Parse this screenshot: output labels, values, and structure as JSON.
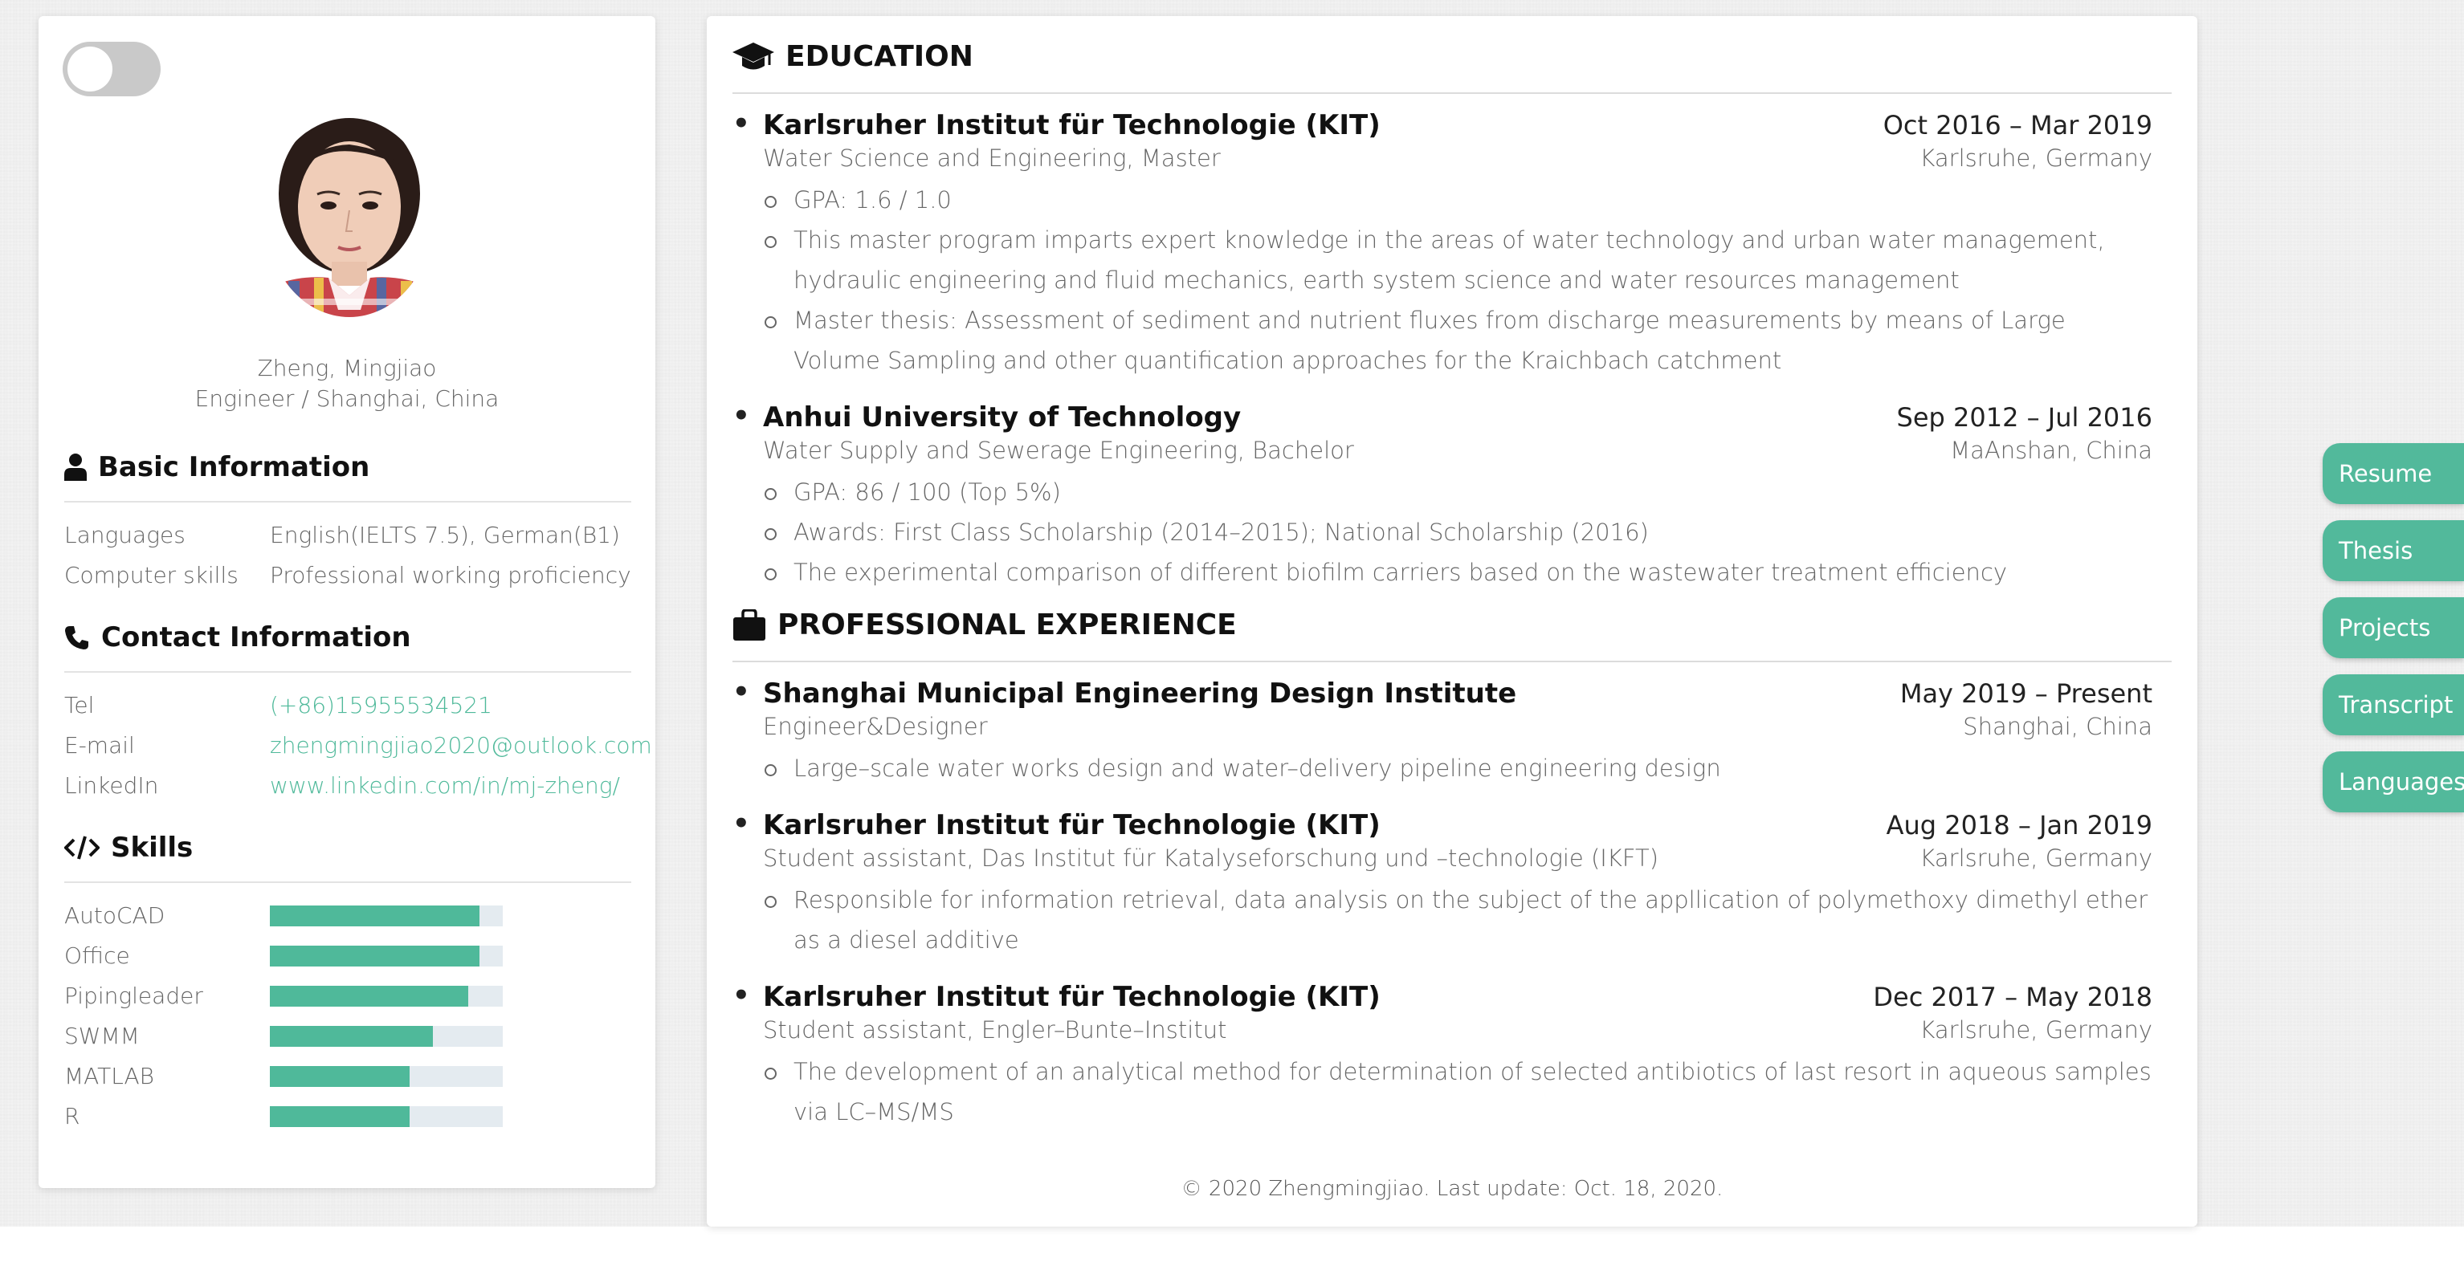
{
  "profile": {
    "name": "Zheng, Mingjiao",
    "title": "Engineer / Shanghai, China"
  },
  "basic_info": {
    "heading": "Basic Information",
    "rows": [
      {
        "k": "Languages",
        "v": "English(IELTS 7.5), German(B1)"
      },
      {
        "k": "Computer skills",
        "v": "Professional working proficiency"
      }
    ]
  },
  "contact": {
    "heading": "Contact Information",
    "rows": [
      {
        "k": "Tel",
        "v": "(+86)15955534521"
      },
      {
        "k": "E-mail",
        "v": "zhengmingjiao2020@outlook.com"
      },
      {
        "k": "LinkedIn",
        "v": "www.linkedin.com/in/mj-zheng/"
      }
    ]
  },
  "skills": {
    "heading": "Skills",
    "items": [
      {
        "name": "AutoCAD",
        "level": 0.9
      },
      {
        "name": "Office",
        "level": 0.9
      },
      {
        "name": "Pipingleader",
        "level": 0.85
      },
      {
        "name": "SWMM",
        "level": 0.7
      },
      {
        "name": "MATLAB",
        "level": 0.6
      },
      {
        "name": "R",
        "level": 0.6
      }
    ]
  },
  "education": {
    "heading": "EDUCATION",
    "entries": [
      {
        "org": "Karlsruher Institut für Technologie (KIT)",
        "date": "Oct 2016 – Mar 2019",
        "role": "Water Science and Engineering, Master",
        "place": "Karlsruhe, Germany",
        "bullets": [
          "GPA: 1.6 / 1.0",
          "This master program imparts expert knowledge in the areas of water technology and urban water management, hydraulic engineering and fluid mechanics, earth system science and water resources management",
          "Master thesis: Assessment of sediment and nutrient fluxes from discharge measurements by means of Large Volume Sampling and other quantification approaches for the Kraichbach catchment"
        ]
      },
      {
        "org": "Anhui University of Technology",
        "date": "Sep 2012 – Jul 2016",
        "role": "Water Supply and Sewerage Engineering, Bachelor",
        "place": "MaAnshan, China",
        "bullets": [
          "GPA: 86 / 100 (Top 5%)",
          "Awards: First Class Scholarship (2014–2015); National Scholarship (2016)",
          "The experimental comparison of different biofilm carriers based on the wastewater treatment efficiency"
        ]
      }
    ]
  },
  "experience": {
    "heading": "PROFESSIONAL EXPERIENCE",
    "entries": [
      {
        "org": "Shanghai Municipal Engineering Design Institute",
        "date": "May 2019 – Present",
        "role": "Engineer&Designer",
        "place": "Shanghai, China",
        "bullets": [
          "Large–scale water works design and water–delivery pipeline engineering design"
        ]
      },
      {
        "org": "Karlsruher Institut für Technologie (KIT)",
        "date": "Aug 2018 – Jan 2019",
        "role": "Student assistant, Das Institut für Katalyseforschung und –technologie (IKFT)",
        "place": "Karlsruhe, Germany",
        "bullets": [
          "Responsible for information retrieval, data analysis on the subject of the appllication of polymethoxy dimethyl ether as a diesel additive"
        ]
      },
      {
        "org": "Karlsruher Institut für Technologie (KIT)",
        "date": "Dec 2017 – May 2018",
        "role": "Student assistant, Engler–Bunte–Institut",
        "place": "Karlsruhe, Germany",
        "bullets": [
          "The development of an analytical method for determination of selected antibiotics of last resort in aqueous samples via LC–MS/MS"
        ]
      }
    ]
  },
  "footer": "© 2020 Zhengmingjiao. Last update: Oct. 18, 2020.",
  "nav": [
    "Resume",
    "Thesis",
    "Projects",
    "Transcript",
    "Languages"
  ],
  "colors": {
    "accent": "#4fb99a",
    "nav": "#52b99b"
  }
}
